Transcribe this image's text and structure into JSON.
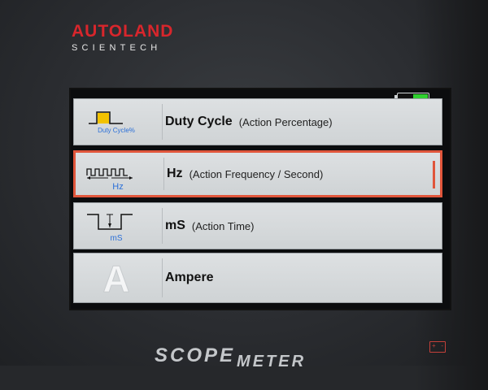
{
  "brand": {
    "name": "AUTOLAND",
    "subtitle": "SCIENTECH"
  },
  "status": {
    "battery_level": 0.5,
    "battery_color": "#2fcf2f"
  },
  "menu": {
    "items": [
      {
        "title": "Duty Cycle",
        "subtitle": "(Action Percentage)",
        "icon": "duty-cycle-icon",
        "icon_caption": "Duty Cycle%",
        "selected": false
      },
      {
        "title": "Hz",
        "subtitle": "(Action Frequency / Second)",
        "icon": "frequency-icon",
        "icon_caption": "Hz",
        "selected": true
      },
      {
        "title": "mS",
        "subtitle": "(Action Time)",
        "icon": "pulse-time-icon",
        "icon_caption": "mS",
        "selected": false
      },
      {
        "title": "Ampere",
        "subtitle": "",
        "icon": "ampere-icon",
        "icon_caption": "A",
        "selected": false
      }
    ]
  },
  "footer": {
    "text_part1": "SCOPE",
    "text_part2": "METER"
  },
  "colors": {
    "selection": "#e0553b",
    "brand_red": "#d8262c",
    "icon_blue": "#2a6fd8",
    "duty_yellow": "#f2c200"
  }
}
